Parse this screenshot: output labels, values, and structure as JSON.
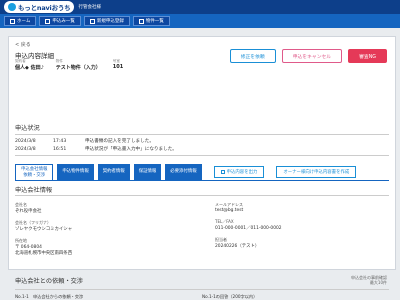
{
  "header": {
    "logo_text": "もっとnaviおうち",
    "company": "行管会社様"
  },
  "nav": {
    "items": [
      {
        "label": "ホーム",
        "icon": "home-icon"
      },
      {
        "label": "申込み一覧",
        "icon": "list-icon"
      },
      {
        "label": "新規申込登録",
        "icon": "add-icon"
      },
      {
        "label": "物件一覧",
        "icon": "building-icon"
      }
    ]
  },
  "page": {
    "back": "< 戻る",
    "title": "申込内容詳細",
    "meta": [
      {
        "key": "契約者",
        "value": "個人◆ 佐田♪"
      },
      {
        "key": "物件",
        "value": "テスト物件（入力）"
      },
      {
        "key": "号室",
        "value": "101"
      }
    ],
    "actions": {
      "correct": "修正を依頼",
      "cancel": "申込をキャンセル",
      "ng": "審査NG"
    }
  },
  "status": {
    "title": "申込状況",
    "rows": [
      {
        "date": "2024/3/8",
        "time": "17:43",
        "text": "申込書類の記入を完了しました。"
      },
      {
        "date": "2024/3/8",
        "time": "16:51",
        "text": "申込状況が「申込書入力中」になりました。"
      }
    ]
  },
  "tabs": {
    "items": [
      {
        "label": "申込会社情報",
        "sublabel": "依頼・交渉",
        "active": true
      },
      {
        "label": "申込物件情報"
      },
      {
        "label": "契約者情報"
      },
      {
        "label": "保証情報"
      },
      {
        "label": "必要添付情報"
      }
    ],
    "export": "申込内容を出力",
    "owner_create": "オーナー様向け申込内容書を作成"
  },
  "company": {
    "title": "申込会社情報",
    "name_label": "会社名",
    "name": "ぞれ役申会社",
    "kana_label": "会社名（フリガナ）",
    "kana": "ゾレヤクモウシコミカイシャ",
    "address_label": "所在地",
    "postal": "〒 064-0804",
    "address": "北海道札幌市中央区南四条西",
    "email_label": "メールアドレス",
    "email": "test@bg.test",
    "tel_label": "TEL／FAX",
    "tel": "011-000-0001／011-000-0002",
    "person_label": "担当者",
    "person": "20240226（テスト）"
  },
  "negotiation": {
    "title": "申込会社との依頼・交渉",
    "note_line1": "申込会社の事前確認",
    "note_line2": "最大10件",
    "col1": "No.1-1　申込会社からの依頼・交渉",
    "col2": "No.1-1の回答（200字以内）"
  }
}
